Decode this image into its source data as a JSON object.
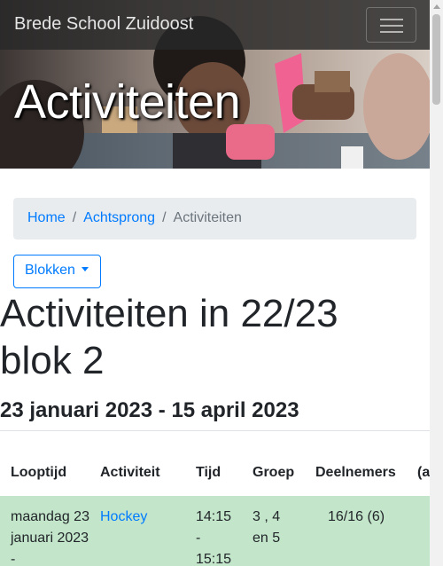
{
  "navbar": {
    "brand": "Brede School Zuidoost",
    "toggle_icon": "menu-icon"
  },
  "hero": {
    "title": "Activiteiten"
  },
  "breadcrumb": {
    "home": "Home",
    "parent": "Achtsprong",
    "current": "Activiteiten",
    "separator": "/"
  },
  "dropdown": {
    "label": "Blokken"
  },
  "page": {
    "heading": "Activiteiten in 22/23 blok 2",
    "period": "23 januari 2023 - 15 april 2023"
  },
  "table": {
    "headers": [
      "Looptijd",
      "Activiteit",
      "Tijd",
      "Groep",
      "Deelnemers",
      "(a"
    ],
    "rows": [
      {
        "looptijd": "maandag 23 januari 2023 -",
        "activiteit": "Hockey",
        "tijd": "14:15 - 15:15",
        "groep": "3 , 4 en 5",
        "deelnemers": "16/16 (6)"
      }
    ]
  },
  "colors": {
    "link": "#007bff",
    "row_success": "#c3e6cb",
    "breadcrumb_bg": "#e9ecef"
  }
}
